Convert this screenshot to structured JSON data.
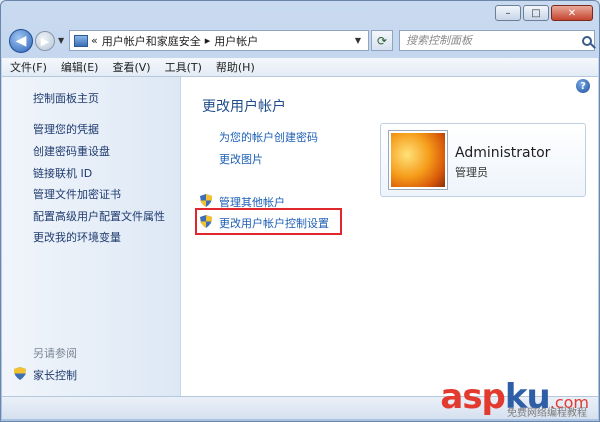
{
  "window": {
    "caption_buttons": {
      "minimize": "–",
      "maximize": "□",
      "close": "✕"
    }
  },
  "address_bar": {
    "prefix": "«",
    "crumbs": [
      "用户帐户和家庭安全",
      "用户帐户"
    ],
    "separator": "▸"
  },
  "search": {
    "placeholder": "搜索控制面板"
  },
  "menu": [
    "文件(F)",
    "编辑(E)",
    "查看(V)",
    "工具(T)",
    "帮助(H)"
  ],
  "left_pane": {
    "home": "控制面板主页",
    "links": [
      "管理您的凭据",
      "创建密码重设盘",
      "链接联机 ID",
      "管理文件加密证书",
      "配置高级用户配置文件属性",
      "更改我的环境变量"
    ],
    "see_also": "另请参阅",
    "parental_controls": "家长控制"
  },
  "main": {
    "title": "更改用户帐户",
    "links": [
      "为您的帐户创建密码",
      "更改图片"
    ],
    "admin_links": [
      "管理其他帐户",
      "更改用户帐户控制设置"
    ]
  },
  "account": {
    "name": "Administrator",
    "role": "管理员"
  },
  "help": "?",
  "watermark": {
    "asp": "asp",
    "ku": "ku",
    "dot": ".com",
    "sub": "免费网络编程教程"
  },
  "colors": {
    "link": "#1d5fb5",
    "highlight_border": "#e0272b",
    "title": "#1f4e8a"
  }
}
